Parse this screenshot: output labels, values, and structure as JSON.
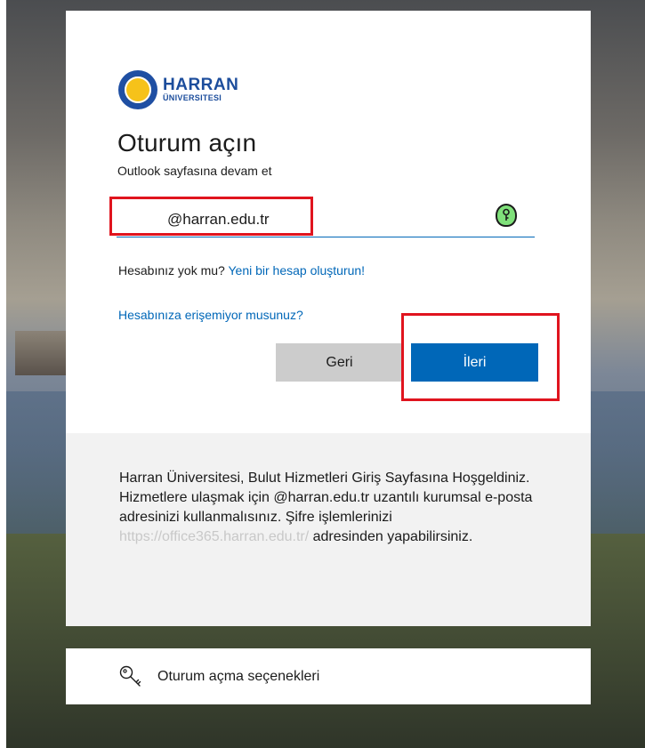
{
  "org": {
    "name": "HARRAN",
    "subname": "ÜNIVERSITESI"
  },
  "signin": {
    "title": "Oturum açın",
    "subtitle": "Outlook sayfasına devam et",
    "email_value": "@harran.edu.tr",
    "no_account_text": "Hesabınız yok mu?",
    "create_account_link": "Yeni bir hesap oluşturun!",
    "cant_access_link": "Hesabınıza erişemiyor musunuz?",
    "back_label": "Geri",
    "next_label": "İleri"
  },
  "info": {
    "text_before": "Harran Üniversitesi, Bulut Hizmetleri Giriş Sayfasına Hoşgeldiniz. Hizmetlere ulaşmak için @harran.edu.tr uzantılı kurumsal e-posta adresinizi kullanmalısınız. Şifre işlemlerinizi",
    "url": "https://office365.harran.edu.tr/",
    "text_after": "adresinden yapabilirsiniz."
  },
  "signin_options": {
    "label": "Oturum açma seçenekleri"
  },
  "colors": {
    "accent": "#0067b8",
    "highlight_box": "#e0141e",
    "back_button": "#cccccc",
    "info_panel": "#f2f2f2"
  },
  "icons": {
    "logo": "university-seal-icon",
    "password_manager": "key-badge-icon",
    "options": "key-icon"
  }
}
